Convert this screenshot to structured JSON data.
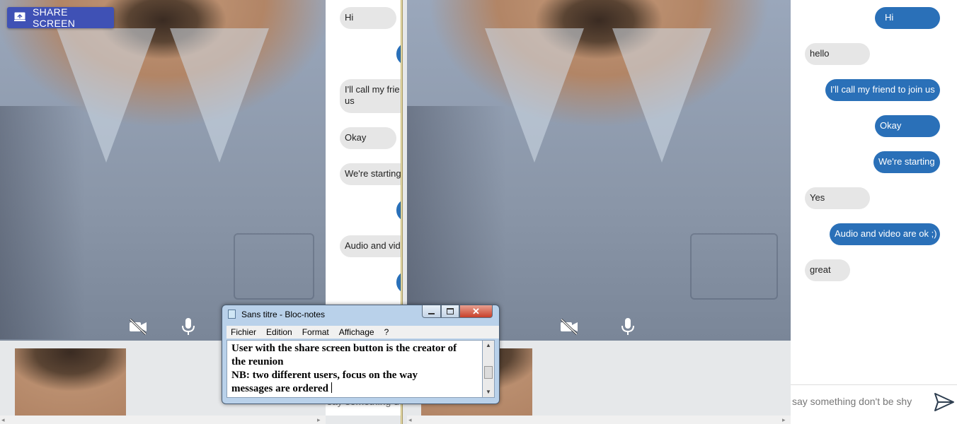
{
  "share_button": {
    "label": "SHARE SCREEN",
    "icon": "screen-share-icon",
    "color": "#3f51b5"
  },
  "left_pane": {
    "video_controls": [
      "camera-off-icon",
      "microphone-icon"
    ],
    "messages": [
      {
        "text": "Hi",
        "side": "received"
      },
      {
        "text": "",
        "side": "sent"
      },
      {
        "text": "I'll call my frie",
        "text2": "us",
        "side": "received"
      },
      {
        "text": "Okay",
        "side": "received"
      },
      {
        "text": "We're starting",
        "side": "received"
      },
      {
        "text": "",
        "side": "sent"
      },
      {
        "text": "Audio and vid",
        "side": "received"
      },
      {
        "text": "",
        "side": "sent"
      }
    ],
    "input_placeholder": "say something d"
  },
  "right_pane": {
    "video_controls": [
      "camera-off-icon",
      "microphone-icon"
    ],
    "messages": [
      {
        "text": "Hi",
        "side": "sent"
      },
      {
        "text": "hello",
        "side": "received"
      },
      {
        "text": "I'll call my friend to join us",
        "side": "sent"
      },
      {
        "text": "Okay",
        "side": "sent"
      },
      {
        "text": "We're starting",
        "side": "sent"
      },
      {
        "text": "Yes",
        "side": "received"
      },
      {
        "text": "Audio and video are ok ;)",
        "side": "sent"
      },
      {
        "text": "great",
        "side": "received"
      }
    ],
    "input_placeholder": "say something don't be shy",
    "send_icon": "send-icon"
  },
  "notepad": {
    "title": "Sans titre - Bloc-notes",
    "menu": [
      "Fichier",
      "Edition",
      "Format",
      "Affichage",
      "?"
    ],
    "lines": [
      "User with the share screen button is the creator of",
      "the reunion",
      "NB: two different users, focus on the way",
      "messages are ordered"
    ]
  },
  "colors": {
    "sent_bubble": "#2a70b8",
    "received_bubble": "#e6e6e6",
    "panel_bg": "#e6e8ea"
  }
}
